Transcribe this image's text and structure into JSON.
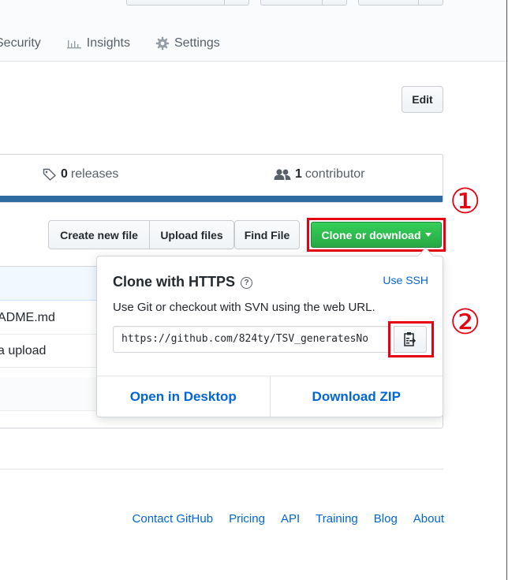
{
  "nav": {
    "tabs": [
      {
        "label": "Security",
        "icon": "shield-icon"
      },
      {
        "label": "Insights",
        "icon": "graph-icon"
      },
      {
        "label": "Settings",
        "icon": "gear-icon"
      }
    ]
  },
  "repo": {
    "edit_label": "Edit",
    "releases_count": "0",
    "releases_label": "releases",
    "contributors_count": "1",
    "contributors_label": "contributor",
    "language_bar_color": "#2e6ba0"
  },
  "file_toolbar": {
    "create_new_file": "Create new file",
    "upload_files": "Upload files",
    "find_file": "Find File",
    "clone_or_download": "Clone or download"
  },
  "files": {
    "rows": [
      "ADME.md",
      "a upload"
    ]
  },
  "clone_dropdown": {
    "title": "Clone with HTTPS",
    "use_ssh": "Use SSH",
    "description": "Use Git or checkout with SVN using the web URL.",
    "url": "https://github.com/824ty/TSV_generatesNo",
    "open_in_desktop": "Open in Desktop",
    "download_zip": "Download ZIP"
  },
  "annotations": {
    "step1": "①",
    "step2": "②",
    "highlight_color": "#e60012"
  },
  "footer": {
    "links": [
      "Contact GitHub",
      "Pricing",
      "API",
      "Training",
      "Blog",
      "About"
    ]
  },
  "colors": {
    "accent_green": "#28a745",
    "link_blue": "#0366d6"
  }
}
